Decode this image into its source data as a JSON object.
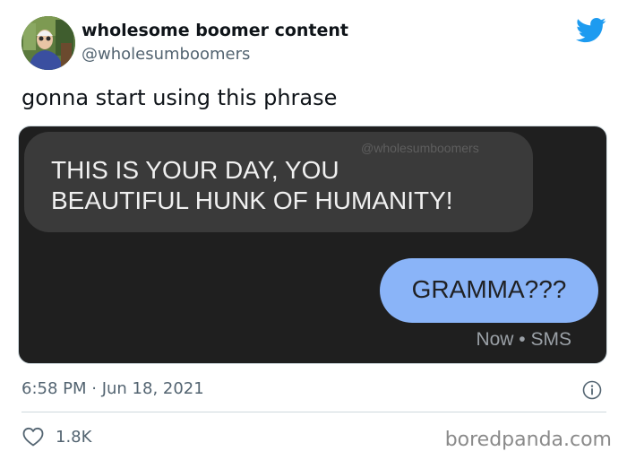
{
  "tweet": {
    "author_name": "wholesome boomer content",
    "author_handle": "@wholesumboomers",
    "text": "gonna start using this phrase",
    "timestamp": "6:58 PM · Jun 18, 2021",
    "likes": "1.8K",
    "brand_color": "#1d9bf0"
  },
  "media": {
    "watermark": "@wholesumboomers",
    "incoming_line_1": "THIS IS YOUR DAY, YOU",
    "incoming_line_2": "BEAUTIFUL HUNK OF HUMANITY!",
    "outgoing": "GRAMMA???",
    "meta": "Now • SMS",
    "background_color": "#1f1f1f",
    "incoming_bubble_color": "#3a3a3a",
    "outgoing_bubble_color": "#8ab4f8"
  },
  "footer": {
    "site": "boredpanda.com"
  },
  "icons": {
    "logo": "twitter-bird-icon",
    "info": "info-icon",
    "like": "heart-icon"
  }
}
